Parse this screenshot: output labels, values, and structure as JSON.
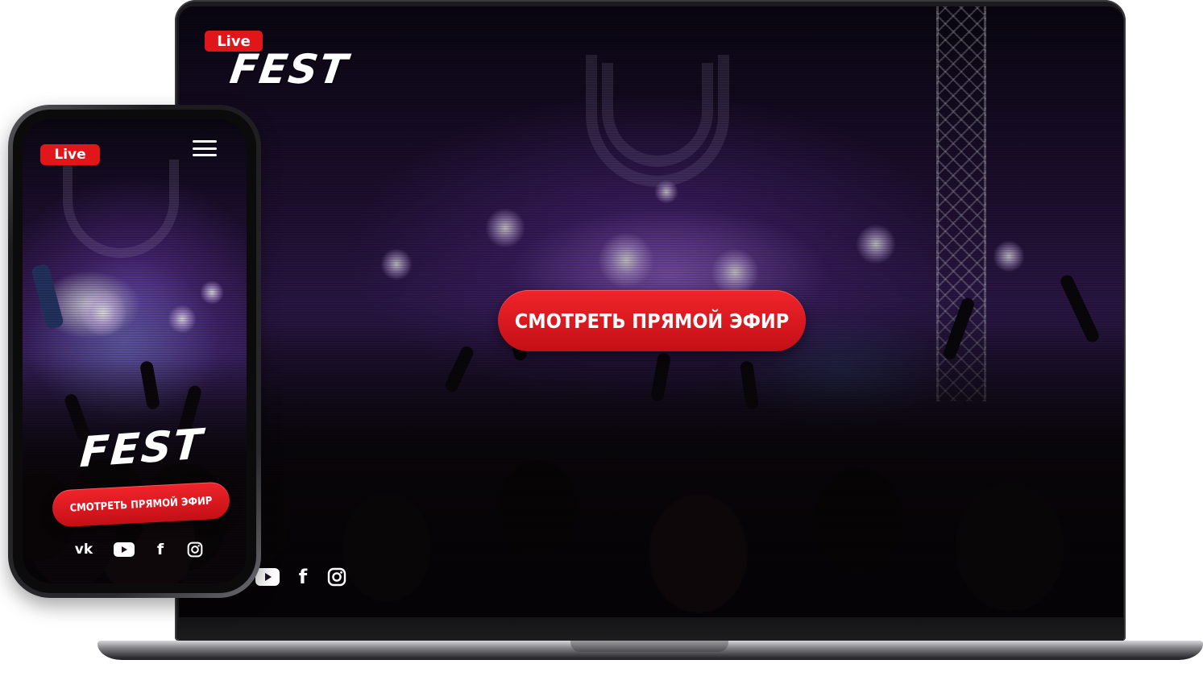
{
  "colors": {
    "accent": "#e0161b",
    "text": "#ffffff",
    "device_frame": "#1b1b1d"
  },
  "laptop": {
    "logo": {
      "badge": "Live",
      "name": "FEST"
    },
    "cta_label": "Смотреть прямой эфир",
    "social_icons": [
      "youtube-icon",
      "facebook-icon",
      "instagram-icon"
    ],
    "social_glyphs": {
      "facebook": "f"
    }
  },
  "phone": {
    "logo": {
      "badge": "Live",
      "name": "FEST"
    },
    "menu_icon": "hamburger-menu-icon",
    "cta_label": "Смотреть прямой эфир",
    "social_icons": [
      "vk-icon",
      "youtube-icon",
      "facebook-icon",
      "instagram-icon"
    ],
    "social_glyphs": {
      "vk": "vk",
      "facebook": "f"
    }
  }
}
